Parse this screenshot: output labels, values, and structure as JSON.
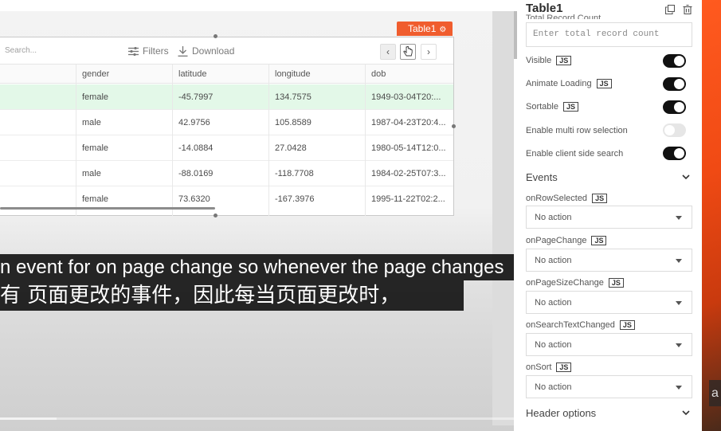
{
  "widget": {
    "tag_label": "Table1"
  },
  "table": {
    "search_placeholder": "Search...",
    "filters_label": "Filters",
    "download_label": "Download",
    "columns": [
      "gender",
      "latitude",
      "longitude",
      "dob"
    ],
    "rows": [
      {
        "gender": "female",
        "latitude": "-45.7997",
        "longitude": "134.7575",
        "dob": "1949-03-04T20:..."
      },
      {
        "gender": "male",
        "latitude": "42.9756",
        "longitude": "105.8589",
        "dob": "1987-04-23T20:4..."
      },
      {
        "gender": "female",
        "latitude": "-14.0884",
        "longitude": "27.0428",
        "dob": "1980-05-14T12:0..."
      },
      {
        "gender": "male",
        "latitude": "-88.0169",
        "longitude": "-118.7708",
        "dob": "1984-02-25T07:3..."
      },
      {
        "gender": "female",
        "latitude": "73.6320",
        "longitude": "-167.3976",
        "dob": "1995-11-22T02:2..."
      }
    ]
  },
  "subtitles": {
    "english": "n event for on page change so whenever the page changes",
    "chinese": "有 页面更改的事件，因此每当页面更改时，"
  },
  "video": {
    "progress_fraction": 0.11
  },
  "pane": {
    "title": "Table1",
    "total_record_label": "Total Record Count",
    "total_record_placeholder": "Enter total record count",
    "js_badge": "JS",
    "props": {
      "visible": "Visible",
      "animate_loading": "Animate Loading",
      "sortable": "Sortable",
      "multi_row": "Enable multi row selection",
      "client_search": "Enable client side search"
    },
    "toggles": {
      "visible": true,
      "animate_loading": true,
      "sortable": true,
      "multi_row": false,
      "client_search": true
    },
    "events_heading": "Events",
    "events": {
      "row_selected": {
        "label": "onRowSelected",
        "value": "No action"
      },
      "page_change": {
        "label": "onPageChange",
        "value": "No action"
      },
      "page_size_change": {
        "label": "onPageSizeChange",
        "value": "No action"
      },
      "search_text_changed": {
        "label": "onSearchTextChanged",
        "value": "No action"
      },
      "sort": {
        "label": "onSort",
        "value": "No action"
      }
    },
    "header_options_heading": "Header options"
  },
  "corner_text": "a",
  "colors": {
    "accent": "#f05d2e",
    "selected_row": "#e3f8e8",
    "toggle_on": "#111111"
  }
}
